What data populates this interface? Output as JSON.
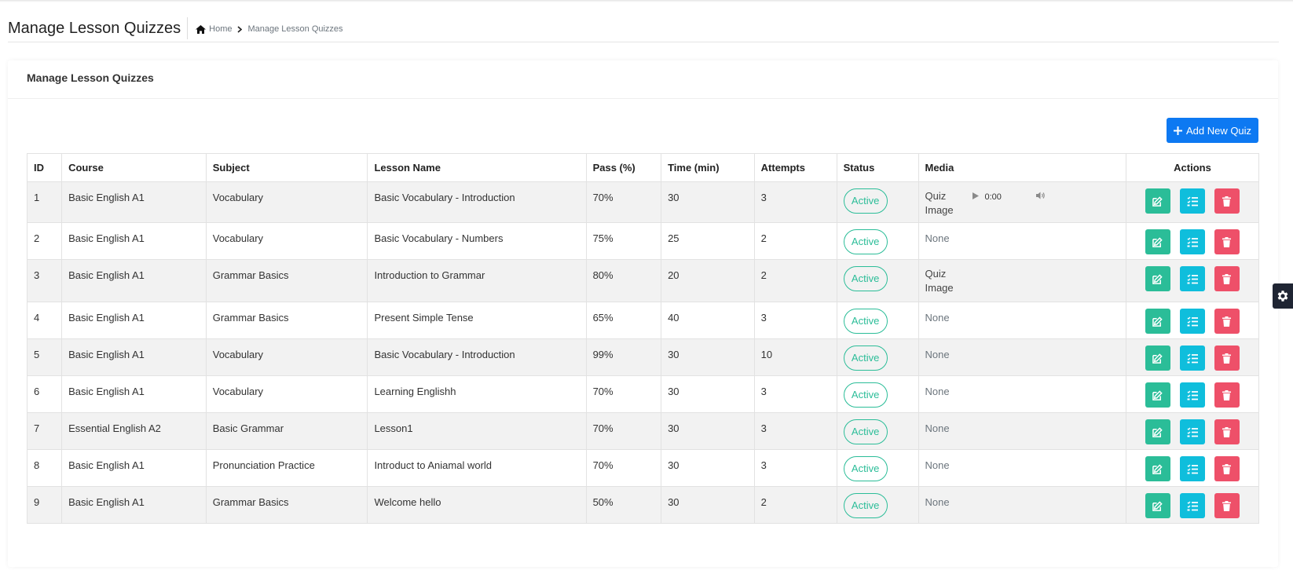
{
  "page": {
    "title": "Manage Lesson Quizzes",
    "breadcrumb": {
      "home": "Home",
      "current": "Manage Lesson Quizzes"
    }
  },
  "card": {
    "title": "Manage Lesson Quizzes",
    "add_button": "Add New Quiz"
  },
  "table": {
    "headers": [
      "ID",
      "Course",
      "Subject",
      "Lesson Name",
      "Pass (%)",
      "Time (min)",
      "Attempts",
      "Status",
      "Media",
      "Actions"
    ],
    "rows": [
      {
        "id": "1",
        "course": "Basic English A1",
        "subject": "Vocabulary",
        "lesson": "Basic Vocabulary - Introduction",
        "pass": "70%",
        "time": "30",
        "attempts": "3",
        "status": "Active",
        "media": "image+audio",
        "image_alt_1": "Quiz",
        "image_alt_2": "Image",
        "audio_time": "0:00"
      },
      {
        "id": "2",
        "course": "Basic English A1",
        "subject": "Vocabulary",
        "lesson": "Basic Vocabulary - Numbers",
        "pass": "75%",
        "time": "25",
        "attempts": "2",
        "status": "Active",
        "media": "None"
      },
      {
        "id": "3",
        "course": "Basic English A1",
        "subject": "Grammar Basics",
        "lesson": "Introduction to Grammar",
        "pass": "80%",
        "time": "20",
        "attempts": "2",
        "status": "Active",
        "media": "image",
        "image_alt_1": "Quiz",
        "image_alt_2": "Image"
      },
      {
        "id": "4",
        "course": "Basic English A1",
        "subject": "Grammar Basics",
        "lesson": "Present Simple Tense",
        "pass": "65%",
        "time": "40",
        "attempts": "3",
        "status": "Active",
        "media": "None"
      },
      {
        "id": "5",
        "course": "Basic English A1",
        "subject": "Vocabulary",
        "lesson": "Basic Vocabulary - Introduction",
        "pass": "99%",
        "time": "30",
        "attempts": "10",
        "status": "Active",
        "media": "None"
      },
      {
        "id": "6",
        "course": "Basic English A1",
        "subject": "Vocabulary",
        "lesson": "Learning Englishh",
        "pass": "70%",
        "time": "30",
        "attempts": "3",
        "status": "Active",
        "media": "None"
      },
      {
        "id": "7",
        "course": "Essential English A2",
        "subject": "Basic Grammar",
        "lesson": "Lesson1",
        "pass": "70%",
        "time": "30",
        "attempts": "3",
        "status": "Active",
        "media": "None"
      },
      {
        "id": "8",
        "course": "Basic English A1",
        "subject": "Pronunciation Practice",
        "lesson": "Introduct to Aniamal world",
        "pass": "70%",
        "time": "30",
        "attempts": "3",
        "status": "Active",
        "media": "None"
      },
      {
        "id": "9",
        "course": "Basic English A1",
        "subject": "Grammar Basics",
        "lesson": "Welcome hello",
        "pass": "50%",
        "time": "30",
        "attempts": "2",
        "status": "Active",
        "media": "None"
      }
    ]
  },
  "icons": {
    "edit": "edit-icon",
    "questions": "list-check-icon",
    "delete": "trash-icon",
    "settings": "gear-icon"
  },
  "colors": {
    "primary": "#0d79f2",
    "success": "#2bbd98",
    "info": "#0fbedc",
    "danger": "#ee5069"
  }
}
